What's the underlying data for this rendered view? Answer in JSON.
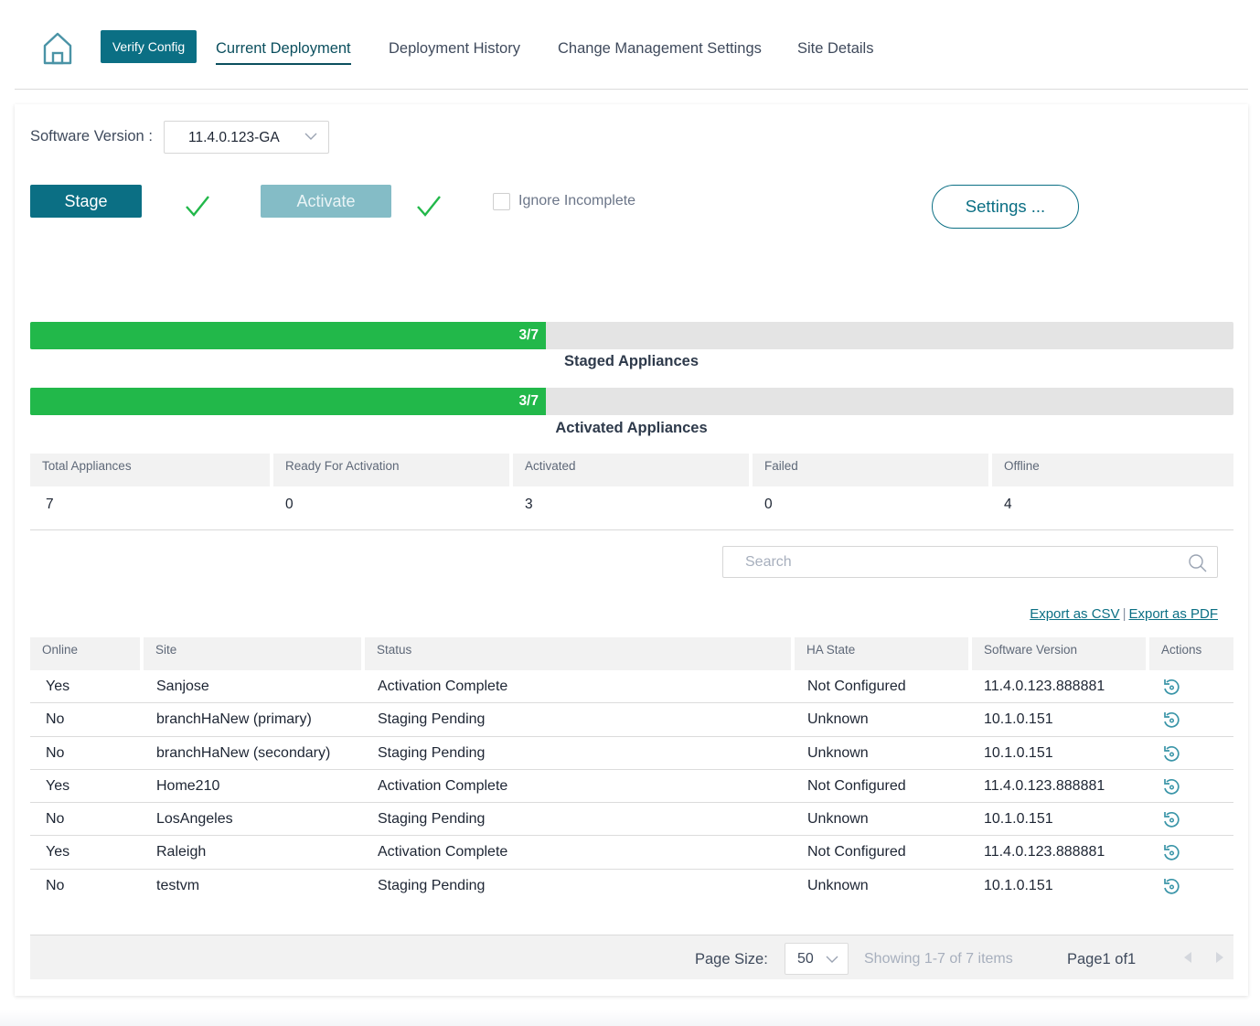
{
  "nav": {
    "home_icon": "home-icon",
    "verify_config": "Verify Config",
    "tabs": [
      {
        "label": "Current Deployment",
        "active": true
      },
      {
        "label": "Deployment History",
        "active": false
      },
      {
        "label": "Change Management Settings",
        "active": false
      },
      {
        "label": "Site Details",
        "active": false
      }
    ]
  },
  "controls": {
    "software_version_label": "Software Version :",
    "software_version_value": "11.4.0.123-GA",
    "stage_label": "Stage",
    "stage_done": true,
    "activate_label": "Activate",
    "activate_done": true,
    "ignore_incomplete_label": "Ignore Incomplete",
    "ignore_incomplete_checked": false,
    "settings_label": "Settings ..."
  },
  "progress": {
    "staged": {
      "label": "Staged Appliances",
      "text": "3/7",
      "done": 3,
      "total": 7
    },
    "activated": {
      "label": "Activated Appliances",
      "text": "3/7",
      "done": 3,
      "total": 7
    }
  },
  "stats": [
    {
      "label": "Total Appliances",
      "value": "7"
    },
    {
      "label": "Ready For Activation",
      "value": "0"
    },
    {
      "label": "Activated",
      "value": "3"
    },
    {
      "label": "Failed",
      "value": "0"
    },
    {
      "label": "Offline",
      "value": "4"
    }
  ],
  "search": {
    "placeholder": "Search",
    "value": ""
  },
  "exports": {
    "csv": "Export as CSV",
    "separator": "|",
    "pdf": "Export as PDF"
  },
  "table": {
    "columns": [
      "Online",
      "Site",
      "Status",
      "HA State",
      "Software Version",
      "Actions"
    ],
    "rows": [
      {
        "online": "Yes",
        "site": "Sanjose",
        "status": "Activation Complete",
        "ha_state": "Not Configured",
        "version": "11.4.0.123.888881",
        "action_icon": "revert-icon"
      },
      {
        "online": "No",
        "site": "branchHaNew (primary)",
        "status": "Staging Pending",
        "ha_state": "Unknown",
        "version": "10.1.0.151",
        "action_icon": "revert-icon"
      },
      {
        "online": "No",
        "site": "branchHaNew (secondary)",
        "status": "Staging Pending",
        "ha_state": "Unknown",
        "version": "10.1.0.151",
        "action_icon": "revert-icon"
      },
      {
        "online": "Yes",
        "site": "Home210",
        "status": "Activation Complete",
        "ha_state": "Not Configured",
        "version": "11.4.0.123.888881",
        "action_icon": "revert-icon"
      },
      {
        "online": "No",
        "site": "LosAngeles",
        "status": "Staging Pending",
        "ha_state": "Unknown",
        "version": "10.1.0.151",
        "action_icon": "revert-icon"
      },
      {
        "online": "Yes",
        "site": "Raleigh",
        "status": "Activation Complete",
        "ha_state": "Not Configured",
        "version": "11.4.0.123.888881",
        "action_icon": "revert-icon"
      },
      {
        "online": "No",
        "site": "testvm",
        "status": "Staging Pending",
        "ha_state": "Unknown",
        "version": "10.1.0.151",
        "action_icon": "revert-icon"
      }
    ]
  },
  "pager": {
    "page_size_label": "Page Size:",
    "page_size_value": "50",
    "showing": "Showing 1-7 of 7 items",
    "page_text": "Page1 of1"
  },
  "colors": {
    "brand": "#0b6f84",
    "brand_disabled": "#84bcc6",
    "progress_fill": "#22b84a",
    "progress_track": "#e4e4e4",
    "check": "#22b84a"
  }
}
